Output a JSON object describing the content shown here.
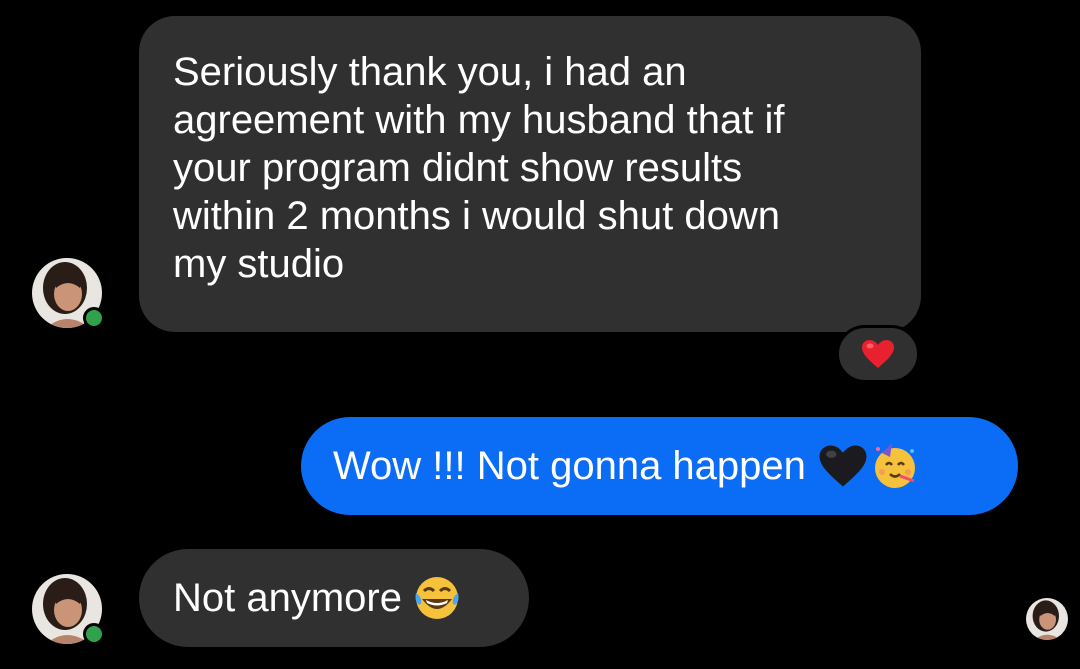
{
  "conversation": {
    "messages": [
      {
        "sender": "other",
        "lines": [
          "Seriously thank you, i had an",
          "agreement with my husband that if",
          "your program didnt show results",
          "within 2 months i would shut down",
          "my studio"
        ],
        "reaction": "heart-emoji"
      },
      {
        "sender": "me",
        "text": "Wow !!! Not gonna happen",
        "emojis": [
          "black-heart-emoji",
          "partying-face-emoji"
        ]
      },
      {
        "sender": "other",
        "text": "Not anymore",
        "emojis": [
          "tears-of-joy-emoji"
        ]
      }
    ]
  },
  "colors": {
    "background": "#000000",
    "incoming_bubble": "#303030",
    "outgoing_bubble": "#0b6cf5",
    "online_indicator": "#31a24c",
    "reaction_heart": "#e8202f"
  }
}
